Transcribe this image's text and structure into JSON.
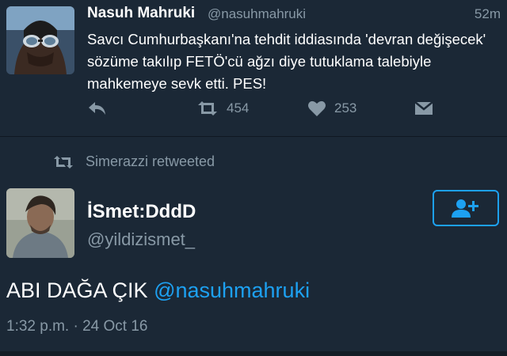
{
  "tweet1": {
    "display_name": "Nasuh Mahruki",
    "handle": "@nasuhmahruki",
    "time": "52m",
    "text": "Savcı Cumhurbaşkanı'na tehdit iddiasında 'devran değişecek' sözüme takılıp FETÖ'cü ağzı diye tutuklama talebiyle mahkemeye sevk etti. PES!",
    "retweet_count": "454",
    "like_count": "253",
    "icons": [
      "reply-icon",
      "retweet-icon",
      "heart-icon",
      "direct-message-icon"
    ]
  },
  "retweet_context": {
    "label": "Simerazzi retweeted"
  },
  "tweet2": {
    "display_name": "İSmet:DddD",
    "handle": "@yildizismet_",
    "text_plain": "ABI DAĞA ÇIK ",
    "mention": "@nasuhmahruki",
    "datetime": "1:32 p.m. · 24 Oct 16",
    "follow_icon": "add-user-icon"
  },
  "colors": {
    "background": "#1b2836",
    "secondary_text": "#8899a6",
    "accent": "#1da1f2"
  }
}
